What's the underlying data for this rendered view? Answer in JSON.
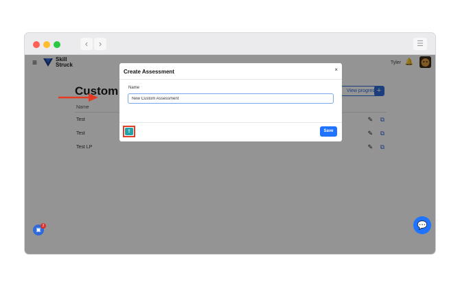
{
  "browser": {
    "back_glyph": "‹",
    "forward_glyph": "›",
    "menu_glyph": "☰",
    "traffic_lights": [
      "#fe5f57",
      "#febc2e",
      "#28c840"
    ]
  },
  "app": {
    "logo_line1": "Skill",
    "logo_line2": "Struck",
    "user_name": "Tyler",
    "bell_glyph": "🔔",
    "hamburger_glyph": "≡"
  },
  "page": {
    "title": "Custom",
    "view_progress_label": "View progress",
    "add_label": "+",
    "column_header": "Name",
    "rows": [
      {
        "name": "Test"
      },
      {
        "name": "Test"
      },
      {
        "name": "Test LP"
      }
    ],
    "edit_glyph": "✎",
    "open_glyph": "⧉"
  },
  "floating": {
    "badge_count": "2",
    "chat_glyph": "💬"
  },
  "modal": {
    "title": "Create Assessment",
    "close_glyph": "×",
    "name_label": "Name",
    "name_value": "New Custom Assessment",
    "upload_glyph": "⇪",
    "save_label": "Save"
  },
  "colors": {
    "accent": "#1f73ff",
    "upload": "#24a2a7",
    "annotation": "#e53a23"
  }
}
